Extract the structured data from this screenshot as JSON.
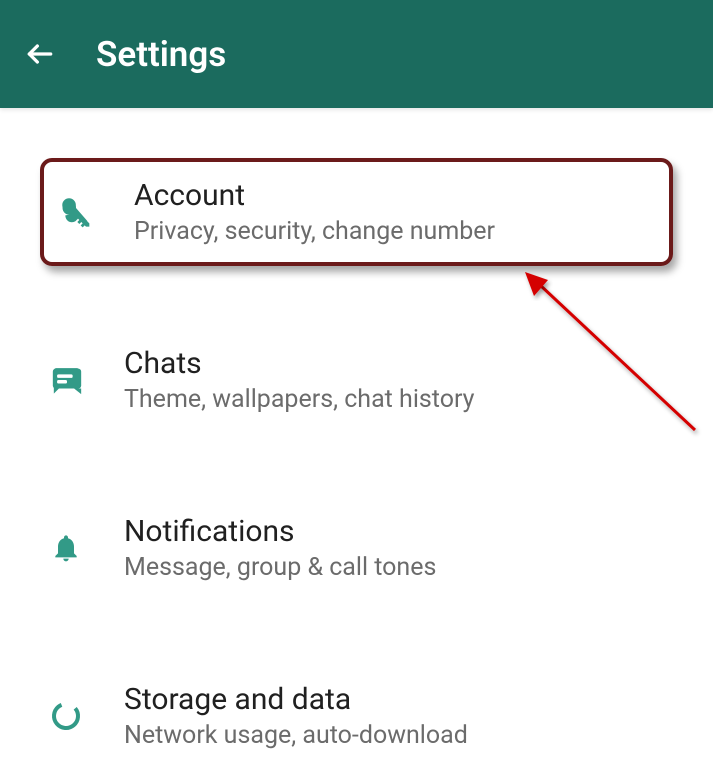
{
  "header": {
    "title": "Settings"
  },
  "colors": {
    "primary": "#1b6b5e",
    "iconTeal": "#329a87",
    "highlight": "#6b1a1a",
    "arrowRed": "#d40000"
  },
  "items": [
    {
      "title": "Account",
      "subtitle": "Privacy, security, change number",
      "icon": "key",
      "highlighted": true
    },
    {
      "title": "Chats",
      "subtitle": "Theme, wallpapers, chat history",
      "icon": "chat",
      "highlighted": false
    },
    {
      "title": "Notifications",
      "subtitle": "Message, group & call tones",
      "icon": "bell",
      "highlighted": false
    },
    {
      "title": "Storage and data",
      "subtitle": "Network usage, auto-download",
      "icon": "data",
      "highlighted": false
    }
  ]
}
